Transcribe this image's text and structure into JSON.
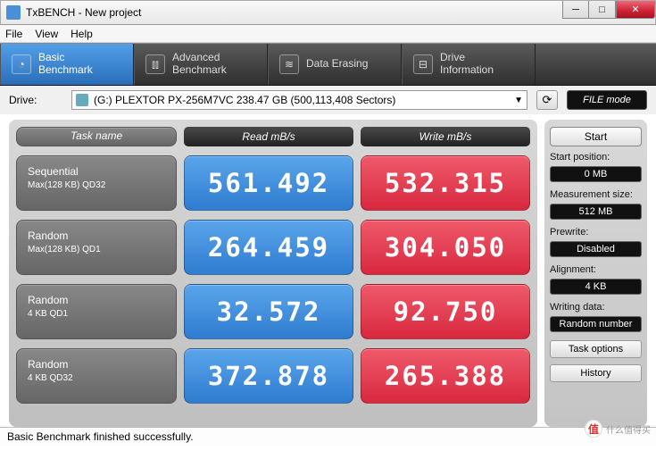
{
  "window": {
    "title": "TxBENCH - New project"
  },
  "menu": {
    "file": "File",
    "view": "View",
    "help": "Help"
  },
  "tabs": {
    "basic": {
      "line1": "Basic",
      "line2": "Benchmark"
    },
    "advanced": {
      "line1": "Advanced",
      "line2": "Benchmark"
    },
    "erase": {
      "line1": "Data Erasing",
      "line2": ""
    },
    "drive": {
      "line1": "Drive",
      "line2": "Information"
    }
  },
  "drive": {
    "label": "Drive:",
    "selected": "(G:) PLEXTOR PX-256M7VC  238.47 GB (500,113,408 Sectors)",
    "filemode": "FILE mode"
  },
  "headers": {
    "task": "Task name",
    "read": "Read mB/s",
    "write": "Write mB/s"
  },
  "rows": [
    {
      "name1": "Sequential",
      "name2": "Max(128 KB) QD32",
      "read": "561.492",
      "write": "532.315"
    },
    {
      "name1": "Random",
      "name2": "Max(128 KB) QD1",
      "read": "264.459",
      "write": "304.050"
    },
    {
      "name1": "Random",
      "name2": "4 KB QD1",
      "read": "32.572",
      "write": "92.750"
    },
    {
      "name1": "Random",
      "name2": "4 KB QD32",
      "read": "372.878",
      "write": "265.388"
    }
  ],
  "side": {
    "start": "Start",
    "start_pos_label": "Start position:",
    "start_pos": "0 MB",
    "meas_label": "Measurement size:",
    "meas": "512 MB",
    "prewrite_label": "Prewrite:",
    "prewrite": "Disabled",
    "align_label": "Alignment:",
    "align": "4 KB",
    "wdata_label": "Writing data:",
    "wdata": "Random number",
    "task_options": "Task options",
    "history": "History"
  },
  "status": "Basic Benchmark finished successfully.",
  "watermark": "什么值得买"
}
